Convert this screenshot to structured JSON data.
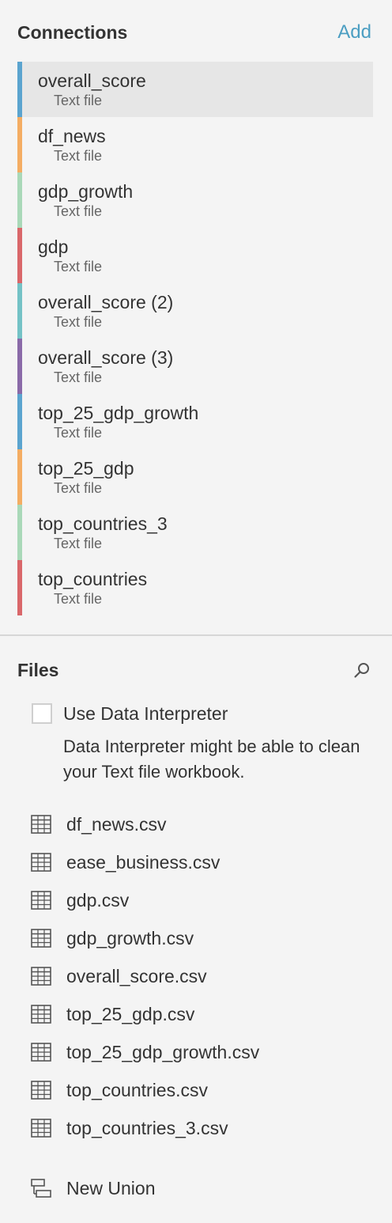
{
  "connections": {
    "title": "Connections",
    "add_label": "Add",
    "items": [
      {
        "name": "overall_score",
        "type": "Text file",
        "color": "#5ba4cf"
      },
      {
        "name": "df_news",
        "type": "Text file",
        "color": "#f4ad63"
      },
      {
        "name": "gdp_growth",
        "type": "Text file",
        "color": "#a9d8b8"
      },
      {
        "name": "gdp",
        "type": "Text file",
        "color": "#d9676a"
      },
      {
        "name": "overall_score (2)",
        "type": "Text file",
        "color": "#74c2c6"
      },
      {
        "name": "overall_score (3)",
        "type": "Text file",
        "color": "#8a6aa8"
      },
      {
        "name": "top_25_gdp_growth",
        "type": "Text file",
        "color": "#5ba4cf"
      },
      {
        "name": "top_25_gdp",
        "type": "Text file",
        "color": "#f4ad63"
      },
      {
        "name": "top_countries_3",
        "type": "Text file",
        "color": "#a9d8b8"
      },
      {
        "name": "top_countries",
        "type": "Text file",
        "color": "#d9676a"
      }
    ],
    "selected_index": 0
  },
  "files": {
    "title": "Files",
    "search_icon": "search-icon",
    "interpreter": {
      "label": "Use Data Interpreter",
      "checked": false,
      "description": "Data Interpreter might be able to clean your Text file workbook."
    },
    "items": [
      "df_news.csv",
      "ease_business.csv",
      "gdp.csv",
      "gdp_growth.csv",
      "overall_score.csv",
      "top_25_gdp.csv",
      "top_25_gdp_growth.csv",
      "top_countries.csv",
      "top_countries_3.csv"
    ],
    "file_icon": "table-grid-icon",
    "new_union": {
      "label": "New Union",
      "icon": "union-icon"
    }
  },
  "colors": {
    "accent": "#4b9ec2",
    "selected_bg": "#e6e6e6",
    "panel_bg": "#f4f4f4"
  }
}
